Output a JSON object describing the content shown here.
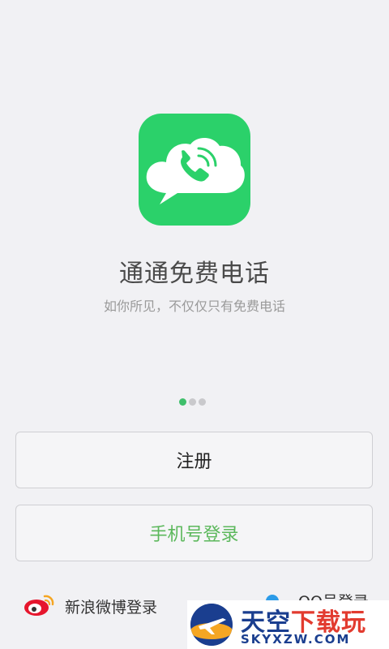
{
  "app": {
    "name": "通通免费电话",
    "tagline": "如你所见，不仅仅只有免费电话"
  },
  "pager": {
    "count": 3,
    "active_index": 0
  },
  "buttons": {
    "register_label": "注册",
    "phone_login_label": "手机号登录"
  },
  "social": {
    "weibo_label": "新浪微博登录",
    "qq_label": "QQ号登录"
  },
  "watermark": {
    "main_text_a": "天空",
    "main_text_b": "下载玩",
    "sub_text": "SKYXZW.COM"
  },
  "colors": {
    "icon_green": "#2bd16a",
    "phone_login_green": "#5cb85c",
    "weibo_red": "#e6162d",
    "qq_blue": "#2c9be8",
    "watermark_blue": "#1a3e8f"
  },
  "icons": {
    "app_icon": "cloud-phone-icon",
    "weibo_icon": "weibo-icon",
    "qq_icon": "qq-icon"
  }
}
